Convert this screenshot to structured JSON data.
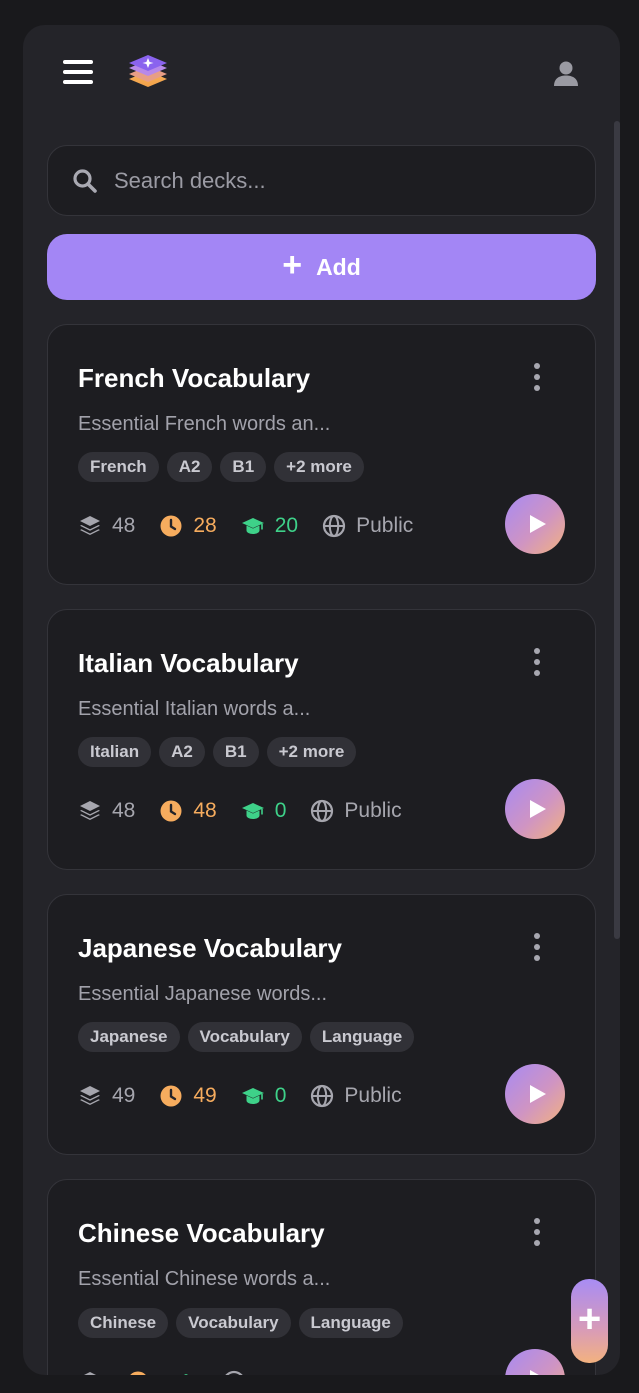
{
  "header": {
    "menu_icon": "hamburger-menu-icon",
    "logo_icon": "layered-stack-logo",
    "profile_icon": "user-profile-icon"
  },
  "search": {
    "placeholder": "Search decks...",
    "value": "",
    "icon": "search-icon"
  },
  "add_button": {
    "label": "Add",
    "icon": "plus-icon"
  },
  "decks": [
    {
      "title": "French Vocabulary",
      "description": "Essential French words an...",
      "tags": [
        "French",
        "A2",
        "B1",
        "+2 more"
      ],
      "cards": "48",
      "due": "28",
      "learned": "20",
      "visibility": "Public"
    },
    {
      "title": "Italian Vocabulary",
      "description": "Essential Italian words a...",
      "tags": [
        "Italian",
        "A2",
        "B1",
        "+2 more"
      ],
      "cards": "48",
      "due": "48",
      "learned": "0",
      "visibility": "Public"
    },
    {
      "title": "Japanese Vocabulary",
      "description": "Essential Japanese words...",
      "tags": [
        "Japanese",
        "Vocabulary",
        "Language"
      ],
      "cards": "49",
      "due": "49",
      "learned": "0",
      "visibility": "Public"
    },
    {
      "title": "Chinese Vocabulary",
      "description": "Essential Chinese words a...",
      "tags": [
        "Chinese",
        "Vocabulary",
        "Language"
      ]
    }
  ],
  "fab": {
    "label": "+",
    "icon": "plus-icon"
  },
  "colors": {
    "accent": "#a386f5",
    "due": "#f6ac5e",
    "learned": "#3ed189",
    "card_bg": "#1d1d21"
  }
}
